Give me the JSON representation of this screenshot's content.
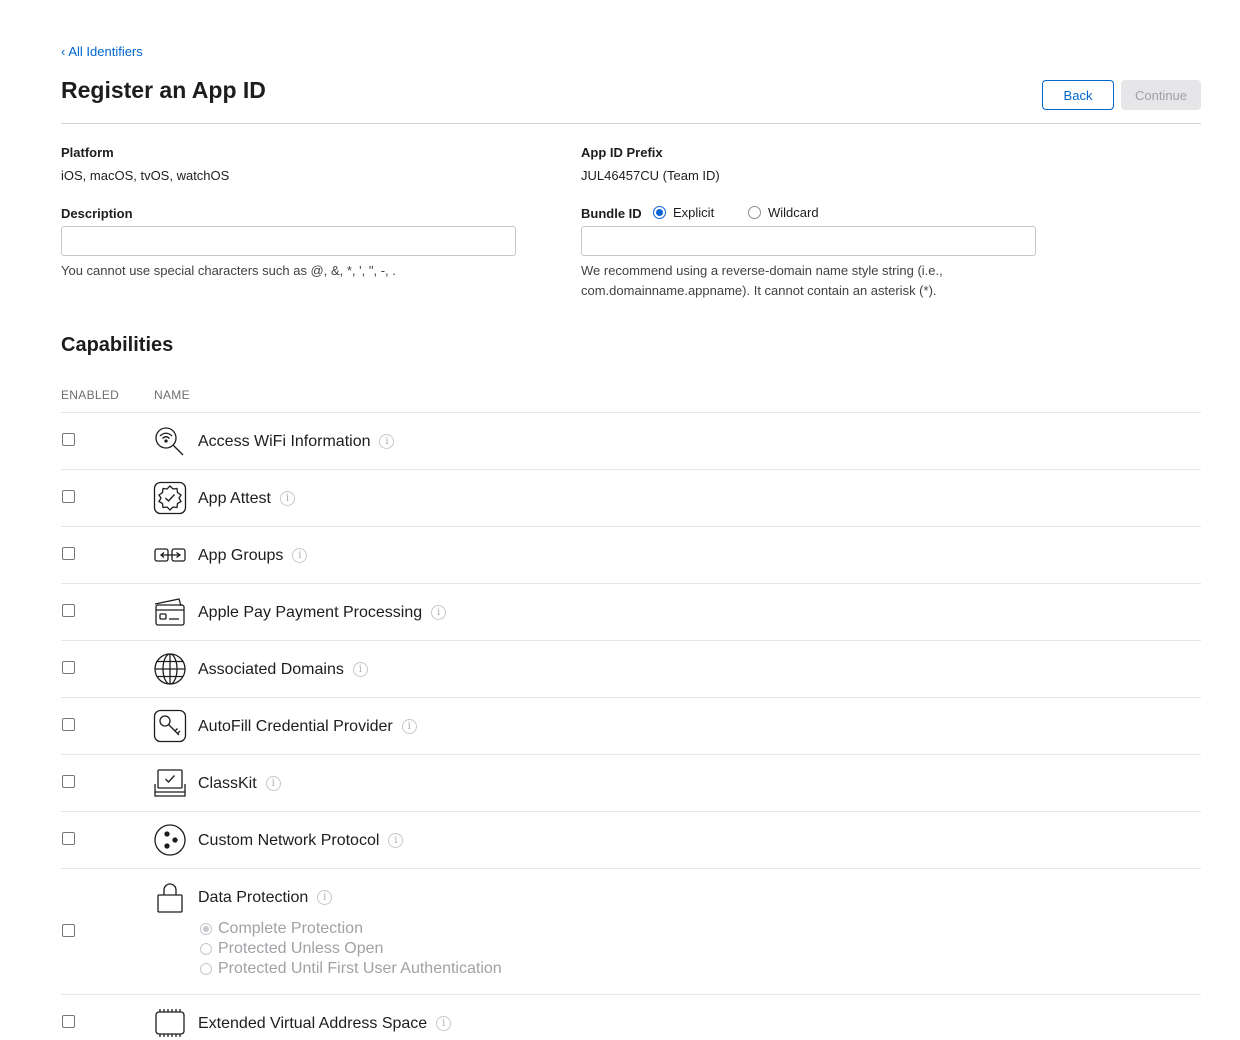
{
  "breadcrumb": {
    "chevron": "‹",
    "label": "All Identifiers"
  },
  "page_title": "Register an App ID",
  "buttons": {
    "back": "Back",
    "continue": "Continue"
  },
  "platform": {
    "label": "Platform",
    "value": "iOS, macOS, tvOS, watchOS"
  },
  "app_id_prefix": {
    "label": "App ID Prefix",
    "value": "JUL46457CU (Team ID)"
  },
  "description": {
    "label": "Description",
    "value": "",
    "help": "You cannot use special characters such as @, &, *, ', \", -, ."
  },
  "bundle_id": {
    "label": "Bundle ID",
    "options": [
      "Explicit",
      "Wildcard"
    ],
    "selected": "Explicit",
    "value": "",
    "help_line1": "We recommend using a reverse-domain name style string (i.e.,",
    "help_line2": "com.domainname.appname). It cannot contain an asterisk (*)."
  },
  "capabilities": {
    "title": "Capabilities",
    "columns": {
      "enabled": "ENABLED",
      "name": "NAME"
    },
    "info_glyph": "i",
    "items": [
      {
        "name": "Access WiFi Information",
        "icon": "wifi-search-icon",
        "enabled": false
      },
      {
        "name": "App Attest",
        "icon": "badge-check-icon",
        "enabled": false
      },
      {
        "name": "App Groups",
        "icon": "app-groups-icon",
        "enabled": false
      },
      {
        "name": "Apple Pay Payment Processing",
        "icon": "credit-card-icon",
        "enabled": false
      },
      {
        "name": "Associated Domains",
        "icon": "globe-icon",
        "enabled": false
      },
      {
        "name": "AutoFill Credential Provider",
        "icon": "key-icon",
        "enabled": false
      },
      {
        "name": "ClassKit",
        "icon": "classkit-icon",
        "enabled": false
      },
      {
        "name": "Custom Network Protocol",
        "icon": "network-protocol-icon",
        "enabled": false
      },
      {
        "name": "Data Protection",
        "icon": "lock-icon",
        "enabled": false,
        "options": [
          "Complete Protection",
          "Protected Unless Open",
          "Protected Until First User Authentication"
        ],
        "selected_option": "Complete Protection"
      },
      {
        "name": "Extended Virtual Address Space",
        "icon": "memory-chip-icon",
        "enabled": false
      }
    ]
  }
}
